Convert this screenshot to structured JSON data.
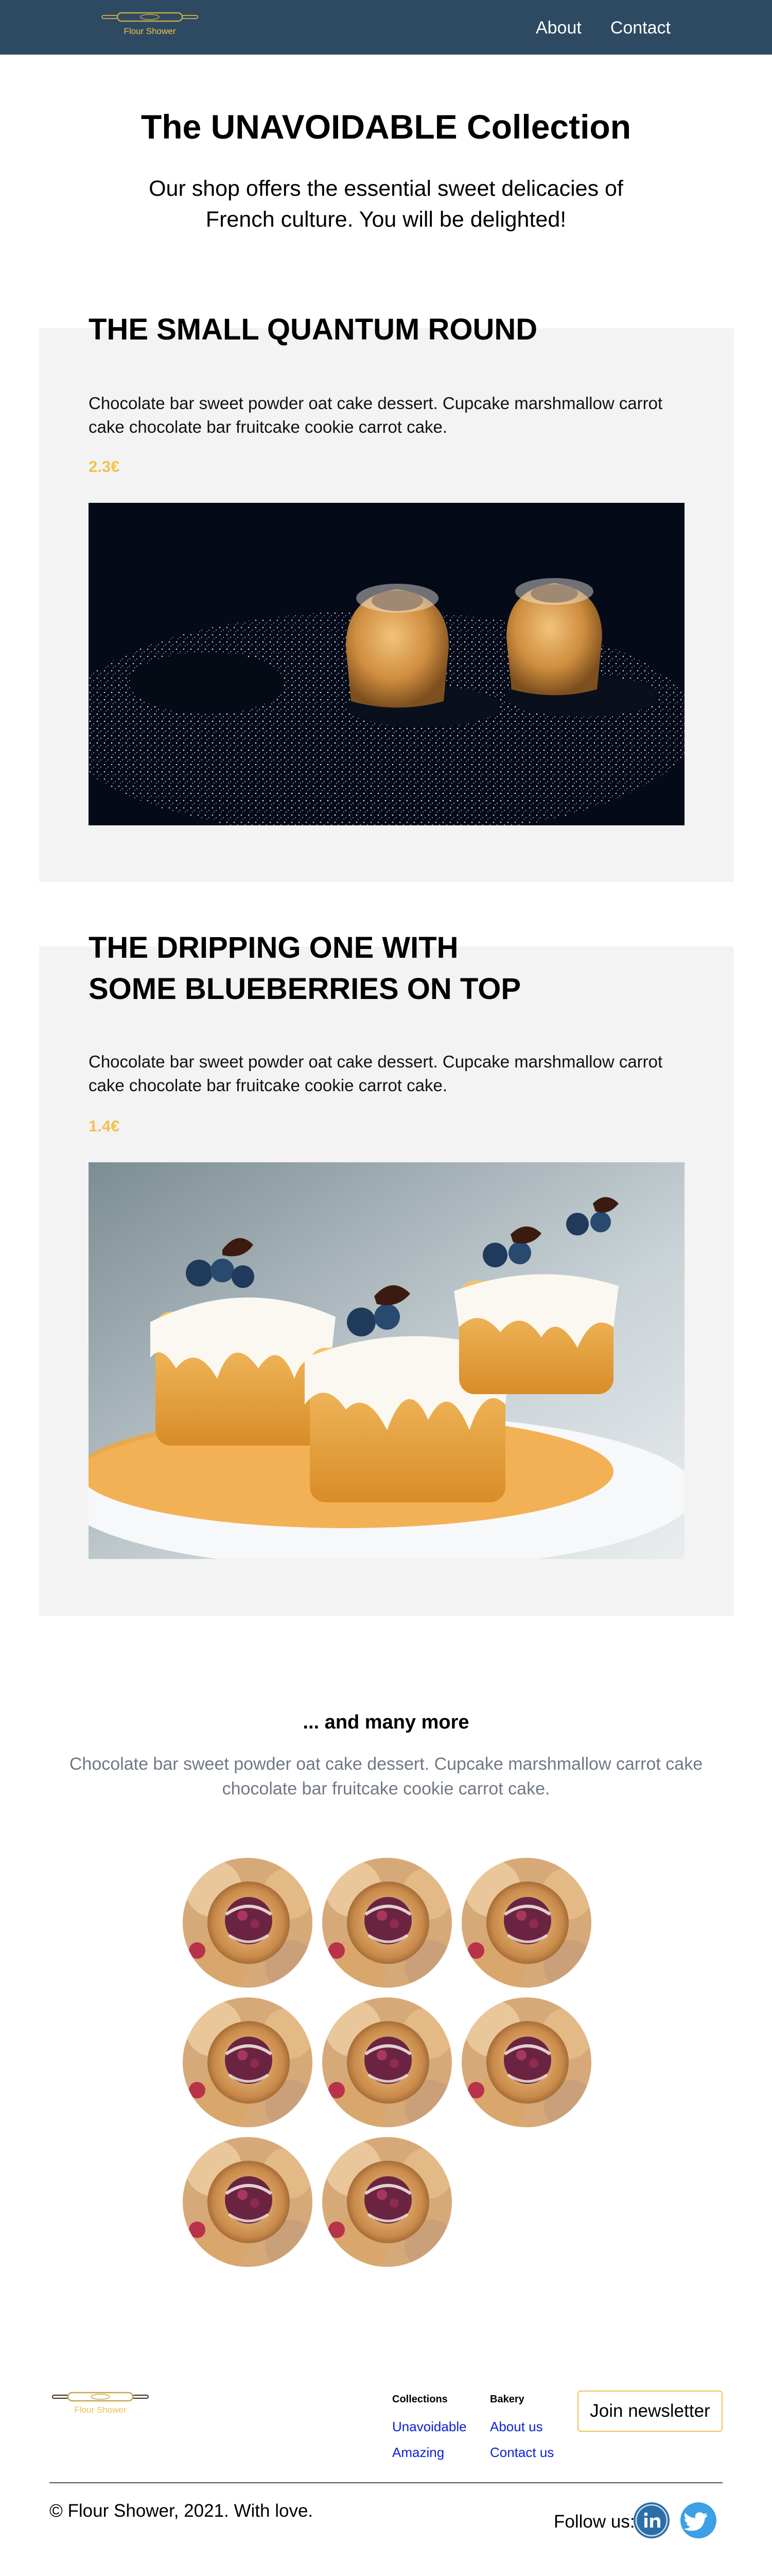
{
  "brand": {
    "name": "Flour Shower"
  },
  "nav": {
    "items": [
      {
        "label": "About"
      },
      {
        "label": "Contact"
      }
    ]
  },
  "hero": {
    "title": "The UNAVOIDABLE Collection",
    "subtitle": "Our shop offers the essential sweet delicacies of French culture. You will be delighted!"
  },
  "products": [
    {
      "title": "THE SMALL QUANTUM ROUND",
      "description": "Chocolate bar sweet powder oat cake dessert. Cupcake marshmallow carrot cake chocolate bar fruitcake cookie carrot cake.",
      "price": "2.3€",
      "image": "bundt-cakes-sugar-photo"
    },
    {
      "title": "THE DRIPPING ONE WITH SOME BLUEBERRIES ON TOP",
      "description": "Chocolate bar sweet powder oat cake dessert. Cupcake marshmallow carrot cake chocolate bar fruitcake cookie carrot cake.",
      "price": "1.4€",
      "image": "blueberry-cakes-photo"
    }
  ],
  "more": {
    "title": "... and many more",
    "description": "Chocolate bar sweet powder oat cake dessert. Cupcake marshmallow carrot cake chocolate bar fruitcake cookie carrot cake.",
    "thumbnail_count": 8,
    "thumbnail_image": "berry-pastry-photo"
  },
  "footer": {
    "columns": [
      {
        "heading": "Collections",
        "links": [
          "Unavoidable",
          "Amazing"
        ]
      },
      {
        "heading": "Bakery",
        "links": [
          "About us",
          "Contact us"
        ]
      }
    ],
    "newsletter_label": "Join newsletter",
    "copyright": "© Flour Shower, 2021. With love.",
    "follow_label": "Follow us:",
    "social": [
      {
        "name": "linkedin-icon"
      },
      {
        "name": "twitter-icon"
      }
    ]
  },
  "colors": {
    "header": "#2e4a62",
    "card_bg": "#f3f3f3",
    "accent": "#f2c14e",
    "link": "#0b20d9",
    "muted": "#707884",
    "linkedin": "#2c6ea8",
    "twitter": "#3d9fe6"
  }
}
